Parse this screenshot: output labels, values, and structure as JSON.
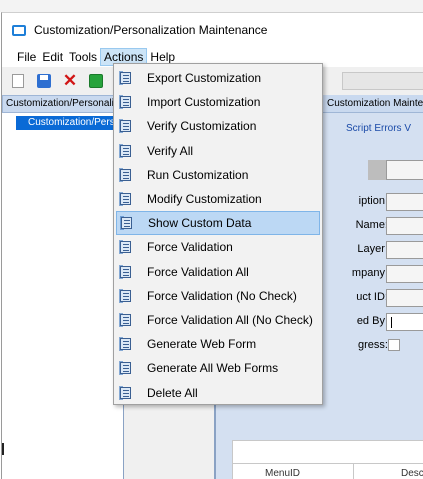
{
  "window": {
    "title": "Customization/Personalization Maintenance"
  },
  "menubar": {
    "items": [
      "File",
      "Edit",
      "Tools",
      "Actions",
      "Help"
    ],
    "open_menu": "Actions"
  },
  "toolbar": {
    "icons": [
      "new-icon",
      "save-icon",
      "delete-icon",
      "refresh-icon"
    ]
  },
  "left_panel": {
    "header": "Customization/Personalization",
    "tree_item": "Customization/Personalization"
  },
  "right_panel": {
    "header": "Customization Maintenance",
    "tabs_text": "Script Errors  V",
    "labels": {
      "description": "iption:",
      "name": "Name:",
      "layer": "Layer:",
      "company": "mpany:",
      "product_id": "uct ID:",
      "created_by": "ed By:",
      "in_progress": "gress:"
    },
    "grid_columns": [
      "MenuID",
      "Desc"
    ]
  },
  "actions_menu": {
    "hovered_index": 6,
    "items": [
      "Export Customization",
      "Import Customization",
      "Verify Customization",
      "Verify All",
      "Run Customization",
      "Modify Customization",
      "Show Custom Data",
      "Force Validation",
      "Force Validation All",
      "Force Validation (No Check)",
      "Force Validation All (No Check)",
      "Generate Web Form",
      "Generate All Web Forms",
      "Delete All"
    ]
  },
  "colors": {
    "menu_hover": "#bcd8f4",
    "tree_selected": "#0a6ad6",
    "panel_bg": "#d4e0f1"
  }
}
